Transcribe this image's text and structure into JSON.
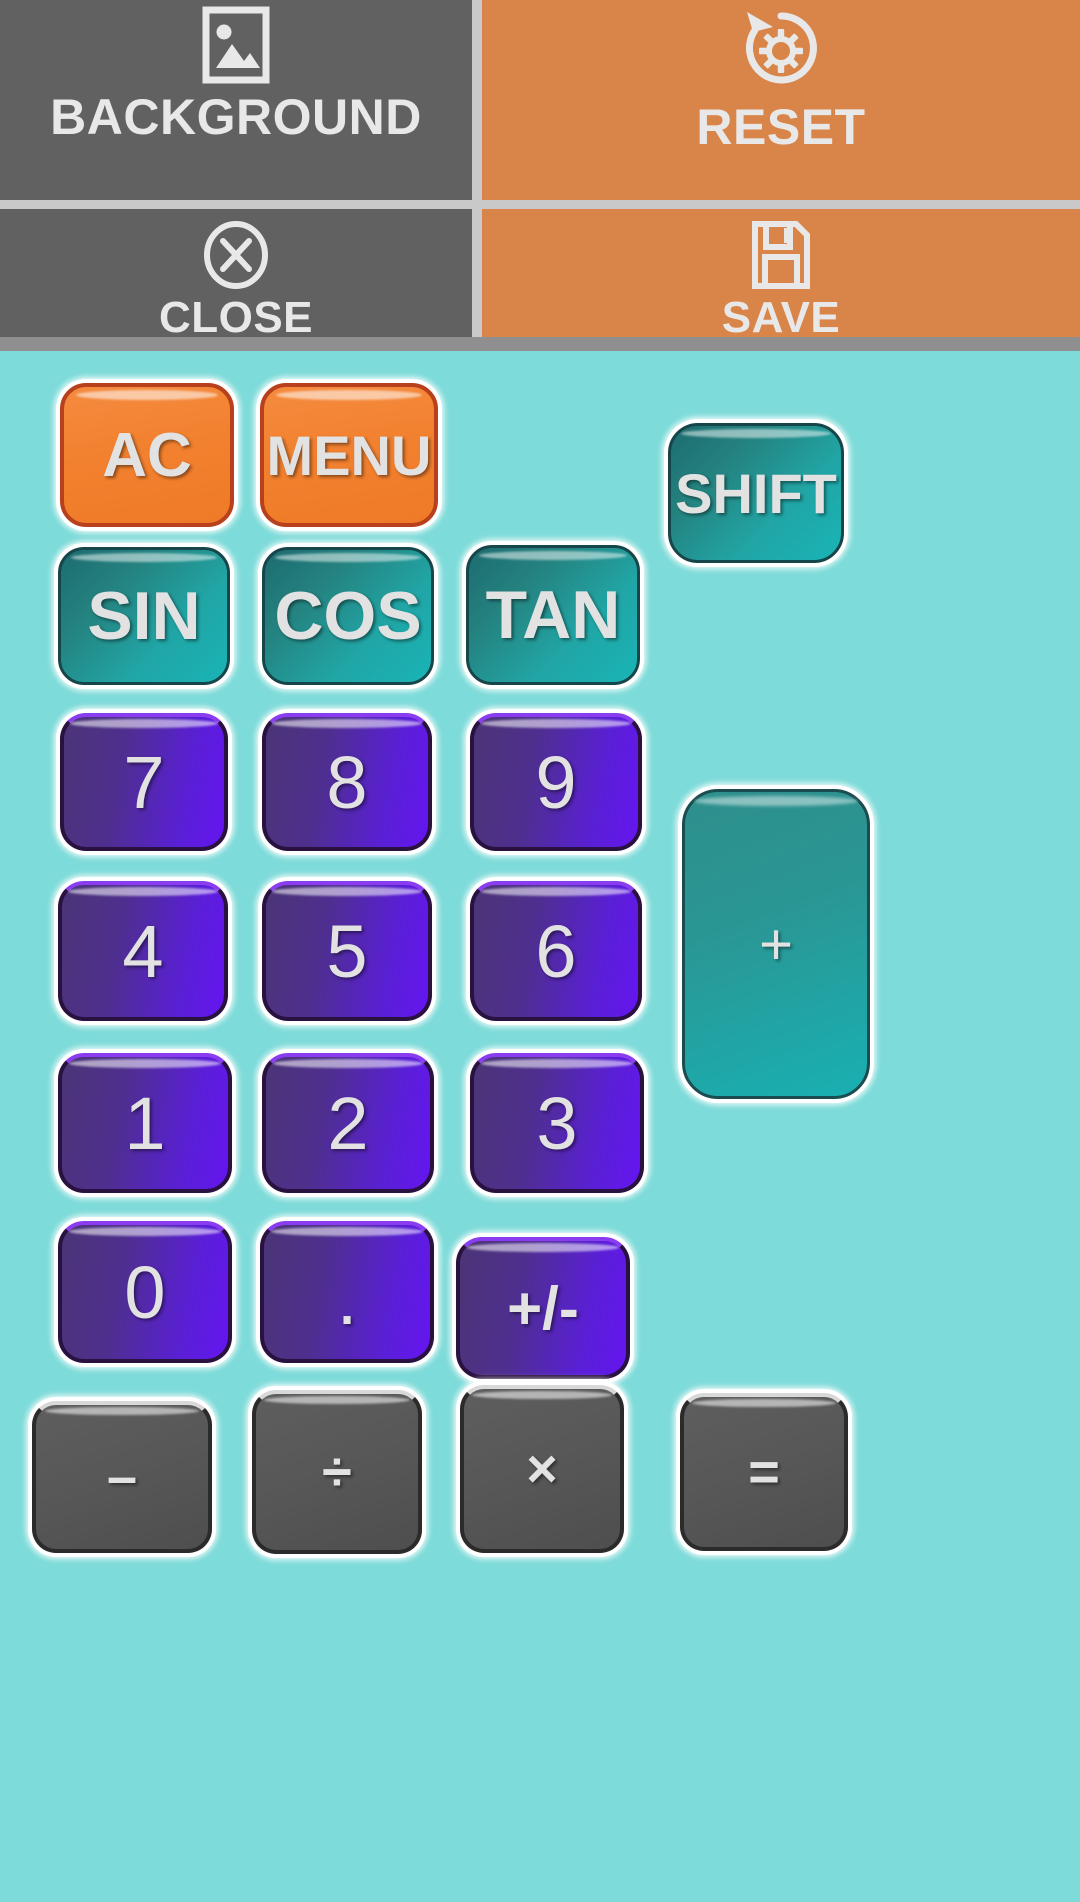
{
  "app": {
    "name": "calculator-customizer",
    "background_color": "#7ddbd9"
  },
  "toolbar": {
    "background_color": "#c9c9c9",
    "gray_color": "#616161",
    "orange_color": "#d9854a",
    "items": [
      {
        "id": "background",
        "label": "BACKGROUND",
        "icon": "image-icon",
        "style": "gray"
      },
      {
        "id": "reset",
        "label": "RESET",
        "icon": "reset-gear-icon",
        "style": "orange"
      },
      {
        "id": "close",
        "label": "CLOSE",
        "icon": "close-circle-icon",
        "style": "gray"
      },
      {
        "id": "save",
        "label": "SAVE",
        "icon": "floppy-save-icon",
        "style": "orange"
      }
    ]
  },
  "keypad": {
    "colors": {
      "orange": "#f2812f",
      "teal": "#21a5a5",
      "purple": "#5a1fd6",
      "gray": "#575757",
      "key_text": "#e2e2e2"
    },
    "keys": {
      "ac": "AC",
      "menu": "MENU",
      "shift": "SHIFT",
      "sin": "SIN",
      "cos": "COS",
      "tan": "TAN",
      "d7": "7",
      "d8": "8",
      "d9": "9",
      "d4": "4",
      "d5": "5",
      "d6": "6",
      "d1": "1",
      "d2": "2",
      "d3": "3",
      "d0": "0",
      "dot": ".",
      "plusminus": "+/-",
      "plus": "+",
      "minus": "–",
      "divide": "÷",
      "multiply": "×",
      "equals": "="
    }
  }
}
